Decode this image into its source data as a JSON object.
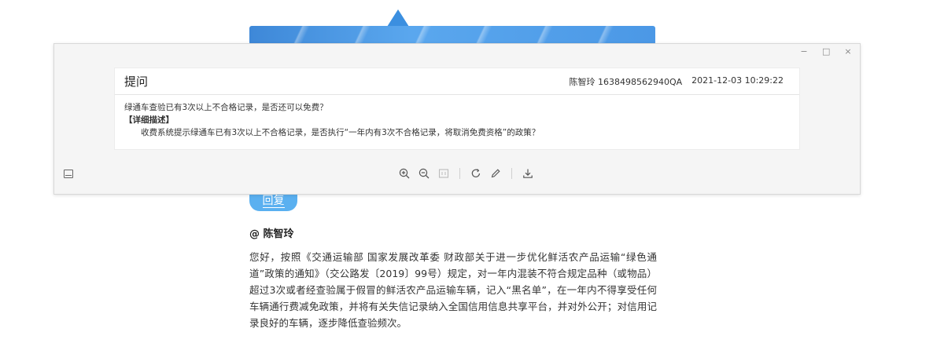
{
  "page": {
    "reply_label": "回复",
    "reply_to": "@ 陈智玲",
    "reply_body": "您好，按照《交通运输部 国家发展改革委 财政部关于进一步优化鲜活农产品运输“绿色通道”政策的通知》（交公路发〔2019〕99号）规定，对一年内混装不符合规定品种（或物品）超过3次或者经查验属于假冒的鲜活农产品运输车辆，记入“黑名单”，在一年内不得享受任何车辆通行费减免政策，并将有关失信记录纳入全国信用信息共享平台，并对外公开；对信用记录良好的车辆，逐步降低查验频次。"
  },
  "viewer": {
    "window_controls": [
      "−",
      "□",
      "×"
    ],
    "card": {
      "title": "提问",
      "author": "陈智玲",
      "question_id": "1638498562940QA",
      "datetime": "2021-12-03 10:29:22",
      "question": "绿通车查验已有3次以上不合格记录，是否还可以免费？",
      "detail_label": "【详细描述】",
      "detail_text": "收费系统提示绿通车已有3次以上不合格记录，是否执行“一年内有3次不合格记录，将取消免费资格”的政策？"
    },
    "toolbar": {
      "icons": [
        "zoom-in-icon",
        "zoom-out-icon",
        "fit-page-icon",
        "rotate-icon",
        "annotate-pen-icon",
        "download-icon"
      ]
    }
  }
}
